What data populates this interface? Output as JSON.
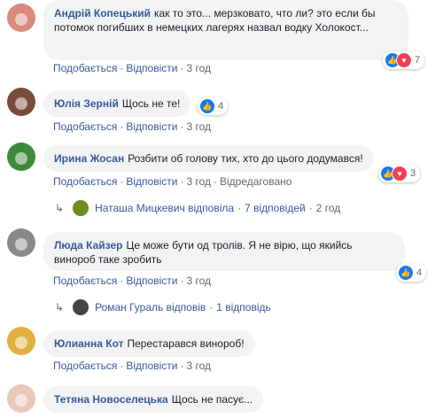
{
  "comments": [
    {
      "author": "Андрій Копецький",
      "text": "как то это... мерзковато, что ли? это если бы потомок погибших в немецких лагерях назвал водку Холокост...",
      "like": "Подобається",
      "reply": "Відповісти",
      "time": "3 год",
      "reactions": {
        "icons": [
          "like-icon",
          "love-icon"
        ],
        "count": "7"
      },
      "avatar_color": "#d98a7a"
    },
    {
      "author": "Юлія Зерній",
      "text": "Щось не те!",
      "like": "Подобається",
      "reply": "Відповісти",
      "time": "3 год",
      "reactions": {
        "icons": [
          "like-icon"
        ],
        "count": "4"
      },
      "avatar_color": "#7a4a3a"
    },
    {
      "author": "Ирина Жосан",
      "text": "Розбити об голову тих, хто до цього додумався!",
      "like": "Подобається",
      "reply": "Відповісти",
      "time": "3 год",
      "edited": "Відредаговано",
      "reactions": {
        "icons": [
          "like-icon",
          "love-icon"
        ],
        "count": "3"
      },
      "avatar_color": "#3d8a3a",
      "replies": {
        "name": "Наташа Мицкевич",
        "verb": "відповіла",
        "count": "7 відповідей",
        "time": "2 год"
      }
    },
    {
      "author": "Люда Кайзер",
      "text": "Це може бути од тролів. Я не вірю, що якийсь винороб таке зробить",
      "like": "Подобається",
      "reply": "Відповісти",
      "time": "3 год",
      "reactions": {
        "icons": [
          "like-icon"
        ],
        "count": "4"
      },
      "avatar_color": "#8a8a8a",
      "replies": {
        "name": "Роман Гураль",
        "verb": "відповів",
        "count": "1 відповідь"
      }
    },
    {
      "author": "Юлианна Кот",
      "text": "Перестарався винороб!",
      "like": "Подобається",
      "reply": "Відповісти",
      "time": "3 год",
      "avatar_color": "#e0b040"
    },
    {
      "author": "Тетяна Новоселецька",
      "text": "Щось не пасує...",
      "avatar_color": "#e8c8b8"
    }
  ],
  "colors": {
    "link": "#385898",
    "bubble": "#f2f3f5",
    "like": "#1877f2",
    "love": "#f33e58"
  }
}
